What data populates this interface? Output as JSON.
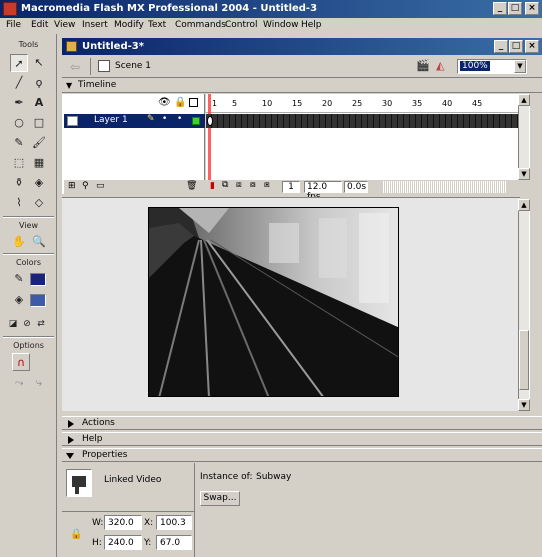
{
  "app": {
    "title": "Macromedia Flash MX Professional 2004 - Untitled-3",
    "window_buttons": [
      "_",
      "□",
      "×"
    ]
  },
  "menu": [
    "File",
    "Edit",
    "View",
    "Insert",
    "Modify",
    "Text",
    "Commands",
    "Control",
    "Window",
    "Help"
  ],
  "tools": {
    "section_tools": "Tools",
    "section_view": "View",
    "section_colors": "Colors",
    "section_options": "Options"
  },
  "document": {
    "title": "Untitled-3*",
    "scene": "Scene 1",
    "zoom": "100%",
    "window_buttons": [
      "_",
      "□",
      "×"
    ]
  },
  "timeline": {
    "label": "Timeline",
    "layer_name": "Layer 1",
    "ruler": [
      "1",
      "5",
      "10",
      "15",
      "20",
      "25",
      "30",
      "35",
      "40",
      "45"
    ],
    "current_frame": "1",
    "frame_rate": "12.0 fps",
    "time": "0.0s"
  },
  "panels": {
    "actions": "Actions",
    "help": "Help",
    "properties": "Properties"
  },
  "properties": {
    "type": "Linked Video",
    "instance_label": "Instance of:",
    "instance_value": "Subway",
    "swap_button": "Swap...",
    "w_label": "W:",
    "w_value": "320.0",
    "h_label": "H:",
    "h_value": "240.0",
    "x_label": "X:",
    "x_value": "100.3",
    "y_label": "Y:",
    "y_value": "67.0"
  },
  "colors": {
    "titlebar_start": "#0a246a",
    "titlebar_end": "#3a6ea5",
    "chrome": "#d4d0c8",
    "stroke_swatch": "#1a237e",
    "fill_swatch": "#3f5aa8"
  }
}
